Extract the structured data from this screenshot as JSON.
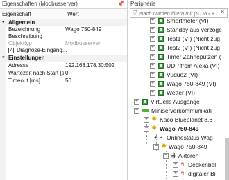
{
  "left": {
    "title": "Eigenschaften (Modbusserver)",
    "pin": "📌",
    "col_name": "Eigenschaft",
    "col_value": "Wert",
    "sections": [
      {
        "label": "Allgemein"
      },
      {
        "label": "Einstellungen"
      }
    ],
    "general": [
      {
        "key": "Bezeichnung",
        "value": "Wago 750-849"
      },
      {
        "key": "Beschreibung",
        "value": ""
      },
      {
        "key": "Objekttyp",
        "value": "Modbusserver"
      },
      {
        "key": "Diagnose-Eingäng...",
        "value": ""
      }
    ],
    "settings": [
      {
        "key": "Adresse",
        "value": "192.168.178.30:502"
      },
      {
        "key": "Wartezeit nach Start [s]",
        "value": "0"
      },
      {
        "key": "Timeout [ms]",
        "value": "50"
      }
    ]
  },
  "right": {
    "title": "Peripherie",
    "search_placeholder": "Nach Namen filtern mit (STRG + F)",
    "clear": "✕",
    "items": [
      {
        "label": "Smartmeter (VI)"
      },
      {
        "label": "Standby aus verzöge"
      },
      {
        "label": "Test1 (VI) (Nicht zug"
      },
      {
        "label": "Test2 (VI) (Nicht zug"
      },
      {
        "label": "Timer Zähneputzen ("
      },
      {
        "label": "UDP from Alexa (VI)"
      },
      {
        "label": "Vuduo2 (VI)"
      },
      {
        "label": "Wago 750-849 (VI)"
      },
      {
        "label": "Wetter (VI)"
      },
      {
        "label": "Virtuelle Ausgänge"
      },
      {
        "label": "Miniserverkommunikati"
      },
      {
        "label": "Kaco Blueplanet 8.6"
      },
      {
        "label": "Wago 750-849"
      },
      {
        "label": "Onlinestatus Wag"
      },
      {
        "label": "Wago 750-849"
      },
      {
        "label": "Aktoren"
      },
      {
        "label": "Deckenbel"
      },
      {
        "label": "digitaler Bi"
      }
    ]
  },
  "colors": {
    "accent_green": "#3aa63a",
    "gear_amber": "#e0a800"
  }
}
